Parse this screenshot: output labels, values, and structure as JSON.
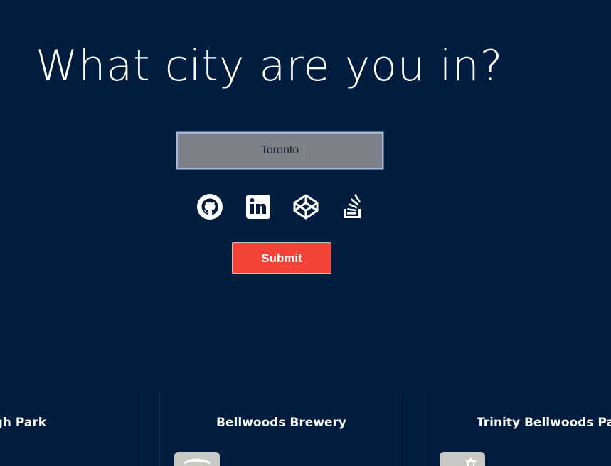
{
  "heading": "What city are you in?",
  "search": {
    "value": "Toronto",
    "placeholder": ""
  },
  "social_links": [
    {
      "icon": "github-icon",
      "label": "GitHub"
    },
    {
      "icon": "linkedin-icon",
      "label": "LinkedIn"
    },
    {
      "icon": "codepen-icon",
      "label": "CodePen"
    },
    {
      "icon": "stackoverflow-icon",
      "label": "Stack Overflow"
    }
  ],
  "submit_label": "Submit",
  "results": [
    {
      "title": "High Park",
      "visible_title": "gh Park"
    },
    {
      "title": "Bellwoods Brewery",
      "visible_title": "Bellwoods Brewery"
    },
    {
      "title": "Trinity Bellwoods Park",
      "visible_title": "Trinity Bellwoods Park"
    }
  ],
  "colors": {
    "background": "#001d40",
    "accent": "#f44336",
    "input_bg": "#7b8089",
    "text": "#ffffff"
  }
}
